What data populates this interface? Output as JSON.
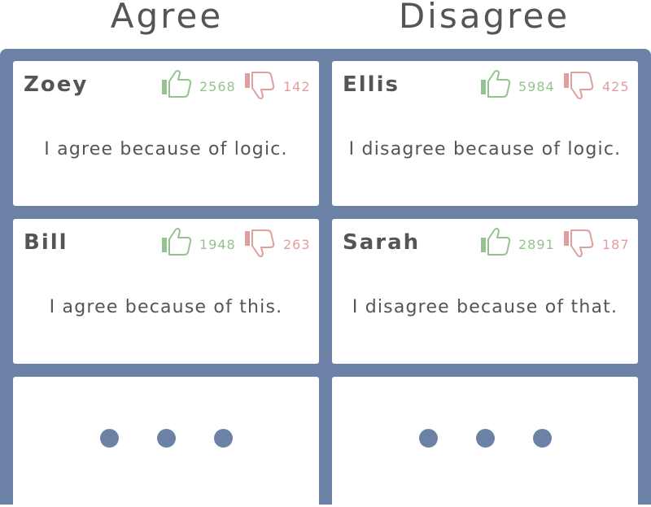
{
  "headers": {
    "agree": "Agree",
    "disagree": "Disagree"
  },
  "colors": {
    "frame": "#6b82a6",
    "thumbs_up": "#93c48d",
    "thumbs_down": "#e29d9d",
    "text": "#555555"
  },
  "agree": [
    {
      "name": "Zoey",
      "upvotes": "2568",
      "downvotes": "142",
      "comment": "I agree because of logic."
    },
    {
      "name": "Bill",
      "upvotes": "1948",
      "downvotes": "263",
      "comment": "I agree because of this."
    }
  ],
  "disagree": [
    {
      "name": "Ellis",
      "upvotes": "5984",
      "downvotes": "425",
      "comment": "I disagree because of logic."
    },
    {
      "name": "Sarah",
      "upvotes": "2891",
      "downvotes": "187",
      "comment": "I disagree because of that."
    }
  ],
  "icons": {
    "upvote": "thumbs-up-icon",
    "downvote": "thumbs-down-icon",
    "more": "ellipsis-icon"
  }
}
